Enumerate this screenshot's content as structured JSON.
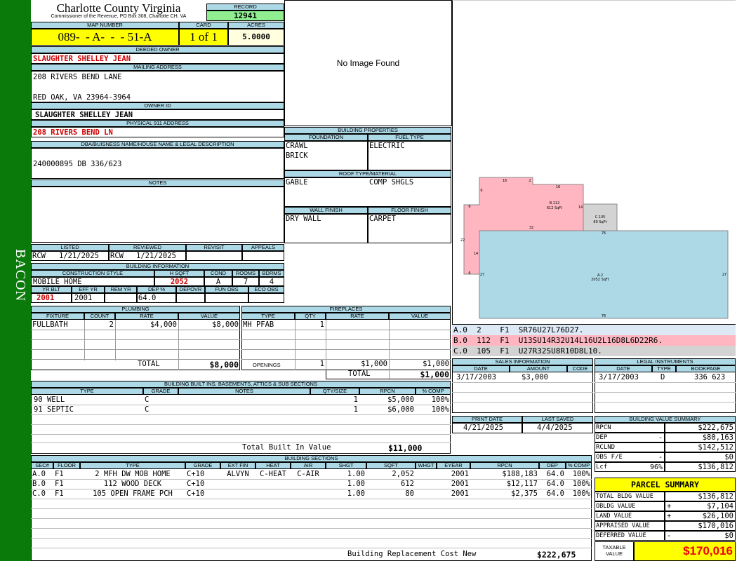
{
  "side_label": "BACON",
  "county": {
    "title": "Charlotte County Virginia",
    "subtitle": "Commissioner of the Revenue, PO Box 308, Charlotte CH, VA"
  },
  "record": {
    "label": "RECORD",
    "value": "12941"
  },
  "map": {
    "label": "MAP NUMBER",
    "value": "089-  - A-  -  - 51-A",
    "card_label": "CARD",
    "card": "1 of 1",
    "acres_label": "ACRES",
    "acres": "5.0000"
  },
  "deeded_owner": {
    "label": "DEEDED OWNER",
    "value": "SLAUGHTER SHELLEY JEAN"
  },
  "mailing": {
    "label": "MAILING ADDRESS",
    "line1": "208 RIVERS BEND LANE",
    "line2": "RED OAK, VA 23964-3964"
  },
  "owner_id": {
    "label": "OWNER ID",
    "value": "SLAUGHTER SHELLEY JEAN"
  },
  "physical": {
    "label": "PHYSICAL 911 ADDRESS",
    "value": "208 RIVERS BEND LN"
  },
  "dba": {
    "label": "DBA/BUISNESS NAME/HOUSE NAME & LEGAL DESCRIPTION",
    "value": "240000895 DB 336/623"
  },
  "notes": {
    "label": "NOTES"
  },
  "image": {
    "text": "No Image Found"
  },
  "listed": {
    "listed_label": "LISTED",
    "reviewed_label": "REVIEWED",
    "revisit_label": "REVISIT",
    "appeals_label": "APPEALS",
    "listed_by": "RCW",
    "listed_date": "1/21/2025",
    "reviewed_by": "RCW",
    "reviewed_date": "1/21/2025"
  },
  "building_info": {
    "label": "BUILDING INFORMATION",
    "h1": [
      "CONSTRUCTION STYLE",
      "H SQFT",
      "COND",
      "ROOMS",
      "BDRMS"
    ],
    "r1": [
      "MOBILE HOME",
      "2052",
      "A",
      "7",
      "4"
    ],
    "h2": [
      "YR BLT",
      "EFF YR",
      "REM YR",
      "DEP %",
      "DEPOVR",
      "FUN OBS",
      "ECO OBS"
    ],
    "r2": [
      "2001",
      "2001",
      "",
      "64.0",
      "",
      "",
      ""
    ]
  },
  "building_props": {
    "label": "BUILDING PROPERTIES",
    "foundation_label": "FOUNDATION",
    "fuel_label": "FUEL TYPE",
    "foundation": [
      "CRAWL",
      "BRICK"
    ],
    "fuel": "ELECTRIC",
    "roof_label": "ROOF TYPE/MATERIAL",
    "roof_type": "GABLE",
    "roof_material": "COMP SHGLS",
    "wall_label": "WALL FINISH",
    "floor_label": "FLOOR FINISH",
    "wall": "DRY WALL",
    "floor": "CARPET"
  },
  "sketch": {
    "a_label": "A.2",
    "a_sqft": "2052 SqFt",
    "b_label": "B.112",
    "b_sqft": "612 SqFt",
    "c_label": "C.105",
    "c_sqft": "80 SqFt",
    "dims": [
      "16",
      "2",
      "16",
      "6",
      "14",
      "6",
      "32",
      "76",
      "22",
      "14",
      "27",
      "27",
      "76",
      "6"
    ]
  },
  "sketch_codes": [
    {
      "line": "A.0  2    F1  SR76U27L76D27."
    },
    {
      "line": "B.0  112  F1  U13SU14R32U14L16U2L16D8L6D22R6."
    },
    {
      "line": "C.0  105  F1  U27R32SU8R10D8L10."
    }
  ],
  "plumbing": {
    "label": "PLUMBING",
    "headers": [
      "FIXTURE",
      "COUNT",
      "RATE",
      "VALUE"
    ],
    "rows": [
      [
        "FULLBATH",
        "2",
        "$4,000",
        "$8,000"
      ]
    ],
    "total_label": "TOTAL",
    "total": "$8,000"
  },
  "fireplaces": {
    "label": "FIREPLACES",
    "headers": [
      "TYPE",
      "QTY",
      "RATE",
      "VALUE"
    ],
    "rows": [
      [
        "MH PFAB",
        "1",
        "",
        ""
      ]
    ],
    "openings_label": "OPENINGS",
    "openings_qty": "1",
    "openings_rate": "$1,000",
    "openings_value": "$1,000",
    "total_label": "TOTAL",
    "total": "$1,000"
  },
  "sales": {
    "label": "SALES INFORMATION",
    "headers": [
      "DATE",
      "AMOUNT",
      "CODE"
    ],
    "rows": [
      [
        "3/17/2003",
        "$3,000",
        ""
      ]
    ]
  },
  "legal": {
    "label": "LEGAL INSTRUMENTS",
    "headers": [
      "DATE",
      "TYPE",
      "BOOKPAGE"
    ],
    "rows": [
      [
        "3/17/2003",
        "D",
        "336 623"
      ]
    ]
  },
  "builtins": {
    "label": "BUILDING BUILT INS, BASEMENTS, ATTICS & SUB SECTIONS",
    "headers": [
      "TYPE",
      "GRADE",
      "NOTES",
      "QTY/SIZE",
      "RPCN",
      "% COMP"
    ],
    "rows": [
      [
        "90 WELL",
        "C",
        "",
        "1",
        "$5,000",
        "100%"
      ],
      [
        "91 SEPTIC",
        "C",
        "",
        "1",
        "$6,000",
        "100%"
      ]
    ],
    "total_label": "Total Built In Value",
    "total": "$11,000"
  },
  "print": {
    "print_label": "PRINT DATE",
    "saved_label": "LAST SAVED",
    "print_date": "4/21/2025",
    "saved_date": "4/4/2025"
  },
  "value_summary": {
    "label": "BUILDING VALUE SUMMARY",
    "rows": [
      {
        "k": "RPCN",
        "op": "",
        "v": "$222,675"
      },
      {
        "k": "DEP",
        "op": "-",
        "v": "$80,163"
      },
      {
        "k": "RCLND",
        "op": "",
        "v": "$142,512"
      },
      {
        "k": "OBS F/E",
        "op": "-",
        "v": "$0"
      },
      {
        "k": "Lcf",
        "op": "96%",
        "v": "$136,812"
      }
    ]
  },
  "sections": {
    "label": "BUILDING SECTIONS",
    "headers": [
      "SEC#",
      "FLOOR",
      "TYPE",
      "GRADE",
      "EXT FIN",
      "HEAT",
      "AIR",
      "SHGT",
      "SQFT",
      "WHGT",
      "EYEAR",
      "RPCN",
      "DEP",
      "% COMP"
    ],
    "rows": [
      [
        "A.0",
        "F1",
        "2 MFH DW MOB HOME",
        "C+10",
        "ALVYN",
        "C-HEAT",
        "C-AIR",
        "1.00",
        "2,052",
        "",
        "2001",
        "$188,183",
        "64.0",
        "100%"
      ],
      [
        "B.0",
        "F1",
        "112 WOOD DECK",
        "C+10",
        "",
        "",
        "",
        "1.00",
        "612",
        "",
        "2001",
        "$12,117",
        "64.0",
        "100%"
      ],
      [
        "C.0",
        "F1",
        "105 OPEN FRAME PCH",
        "C+10",
        "",
        "",
        "",
        "1.00",
        "80",
        "",
        "2001",
        "$2,375",
        "64.0",
        "100%"
      ]
    ],
    "total_label": "Building Replacement Cost New",
    "total": "$222,675"
  },
  "parcel": {
    "label": "PARCEL SUMMARY",
    "rows": [
      {
        "k": "TOTAL BLDG VALUE",
        "op": "",
        "v": "$136,812"
      },
      {
        "k": "OBLDG VALUE",
        "op": "+",
        "v": "$7,104"
      },
      {
        "k": "LAND VALUE",
        "op": "+",
        "v": "$26,100"
      },
      {
        "k": "APPRAISED VALUE",
        "op": "",
        "v": "$170,016"
      },
      {
        "k": "DEFERRED VALUE",
        "op": "-",
        "v": "$0"
      }
    ],
    "taxable_label": "TAXABLE VALUE",
    "taxable": "$170,016"
  },
  "colors": {
    "green": "#0a7a0a",
    "yellow": "#ffff00",
    "header_blue": "#add8e6",
    "record_green": "#90ee90",
    "sketch_a": "#add8e6",
    "sketch_b": "#ffb6c1",
    "sketch_c": "#d3d3d3"
  }
}
